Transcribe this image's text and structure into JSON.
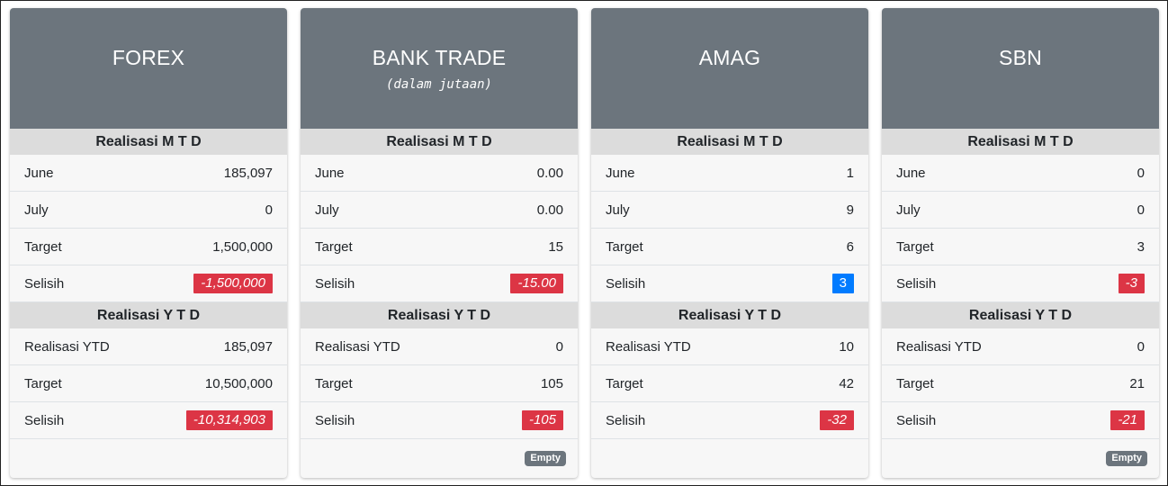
{
  "cards": [
    {
      "title": "FOREX",
      "subtitle": "",
      "mtd_heading": "Realisasi M T D",
      "mtd_rows": [
        {
          "label": "June",
          "value": "185,097"
        },
        {
          "label": "July",
          "value": "0"
        },
        {
          "label": "Target",
          "value": "1,500,000"
        }
      ],
      "mtd_selisih_label": "Selisih",
      "mtd_selisih": "-1,500,000",
      "mtd_selisih_status": "negative",
      "ytd_heading": "Realisasi Y T D",
      "ytd_rows": [
        {
          "label": "Realisasi YTD",
          "value": "185,097"
        },
        {
          "label": "Target",
          "value": "10,500,000"
        }
      ],
      "ytd_selisih_label": "Selisih",
      "ytd_selisih": "-10,314,903",
      "ytd_selisih_status": "negative",
      "footer_badge": ""
    },
    {
      "title": "BANK TRADE",
      "subtitle": "(dalam jutaan)",
      "mtd_heading": "Realisasi M T D",
      "mtd_rows": [
        {
          "label": "June",
          "value": "0.00"
        },
        {
          "label": "July",
          "value": "0.00"
        },
        {
          "label": "Target",
          "value": "15"
        }
      ],
      "mtd_selisih_label": "Selisih",
      "mtd_selisih": "-15.00",
      "mtd_selisih_status": "negative",
      "ytd_heading": "Realisasi Y T D",
      "ytd_rows": [
        {
          "label": "Realisasi YTD",
          "value": "0"
        },
        {
          "label": "Target",
          "value": "105"
        }
      ],
      "ytd_selisih_label": "Selisih",
      "ytd_selisih": "-105",
      "ytd_selisih_status": "negative",
      "footer_badge": "Empty"
    },
    {
      "title": "AMAG",
      "subtitle": "",
      "mtd_heading": "Realisasi M T D",
      "mtd_rows": [
        {
          "label": "June",
          "value": "1"
        },
        {
          "label": "July",
          "value": "9"
        },
        {
          "label": "Target",
          "value": "6"
        }
      ],
      "mtd_selisih_label": "Selisih",
      "mtd_selisih": "3",
      "mtd_selisih_status": "positive",
      "ytd_heading": "Realisasi Y T D",
      "ytd_rows": [
        {
          "label": "Realisasi YTD",
          "value": "10"
        },
        {
          "label": "Target",
          "value": "42"
        }
      ],
      "ytd_selisih_label": "Selisih",
      "ytd_selisih": "-32",
      "ytd_selisih_status": "negative",
      "footer_badge": ""
    },
    {
      "title": "SBN",
      "subtitle": "",
      "mtd_heading": "Realisasi M T D",
      "mtd_rows": [
        {
          "label": "June",
          "value": "0"
        },
        {
          "label": "July",
          "value": "0"
        },
        {
          "label": "Target",
          "value": "3"
        }
      ],
      "mtd_selisih_label": "Selisih",
      "mtd_selisih": "-3",
      "mtd_selisih_status": "negative",
      "ytd_heading": "Realisasi Y T D",
      "ytd_rows": [
        {
          "label": "Realisasi YTD",
          "value": "0"
        },
        {
          "label": "Target",
          "value": "21"
        }
      ],
      "ytd_selisih_label": "Selisih",
      "ytd_selisih": "-21",
      "ytd_selisih_status": "negative",
      "footer_badge": "Empty"
    }
  ],
  "colors": {
    "header_bg": "#6c757d",
    "section_bg": "#dcdcdc",
    "negative": "#dc3545",
    "positive": "#007bff"
  }
}
